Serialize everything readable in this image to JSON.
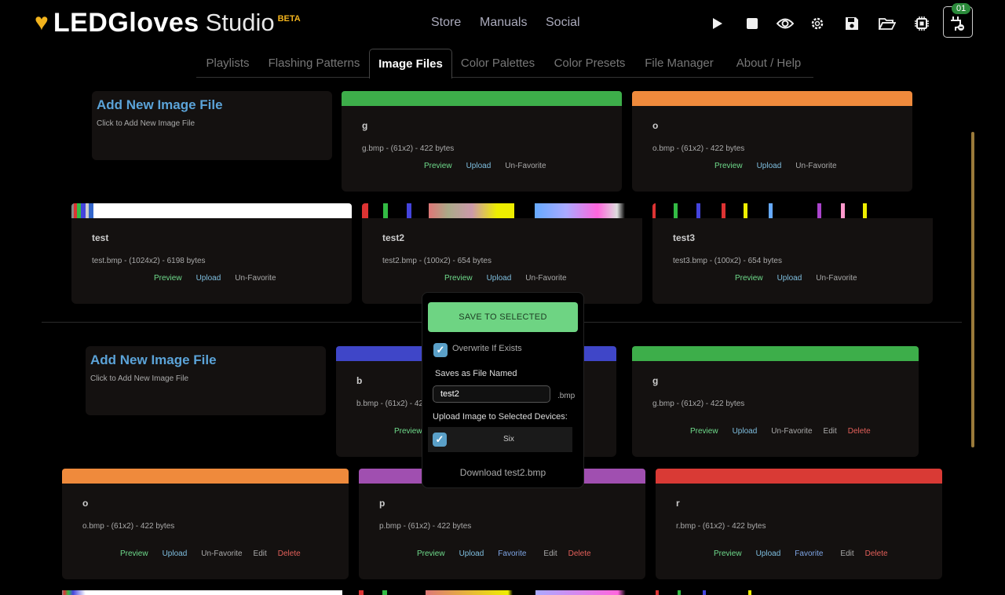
{
  "header": {
    "brand": "LEDGloves",
    "studio": "Studio",
    "beta": "BETA",
    "nav": [
      "Store",
      "Manuals",
      "Social"
    ],
    "device_count": "01",
    "icons": [
      "play-icon",
      "stop-icon",
      "eye-icon",
      "gear-icon",
      "save-icon",
      "folder-open-icon",
      "chip-icon",
      "plug-icon"
    ]
  },
  "tabs": [
    {
      "label": "Playlists",
      "active": false
    },
    {
      "label": "Flashing Patterns",
      "active": false
    },
    {
      "label": "Image Files",
      "active": true
    },
    {
      "label": "Color Palettes",
      "active": false
    },
    {
      "label": "Color Presets",
      "active": false
    },
    {
      "label": "File Manager",
      "active": false
    },
    {
      "label": "About / Help",
      "active": false
    }
  ],
  "add_card": {
    "title": "Add New Image File",
    "subtitle": "Click to Add New Image File"
  },
  "actions": {
    "preview": "Preview",
    "upload": "Upload",
    "unfavorite": "Un-Favorite",
    "favorite": "Favorite",
    "edit": "Edit",
    "delete": "Delete"
  },
  "section1": {
    "files": [
      {
        "name": "g",
        "meta": "g.bmp - (61x2) - 422 bytes",
        "color": "#3dae4a"
      },
      {
        "name": "o",
        "meta": "o.bmp - (61x2) - 422 bytes",
        "color": "#ef8a3c"
      },
      {
        "name": "test",
        "meta": "test.bmp - (1024x2) - 6198 bytes",
        "color": "#ffffff"
      },
      {
        "name": "test2",
        "meta": "test2.bmp - (100x2) - 654 bytes",
        "color": "#000000"
      },
      {
        "name": "test3",
        "meta": "test3.bmp - (100x2) - 654 bytes",
        "color": "#000000"
      }
    ]
  },
  "section2": {
    "files": [
      {
        "name": "b",
        "meta": "b.bmp - (61x2) - 422 bytes",
        "color": "#3f46c8"
      },
      {
        "name": "g",
        "meta": "g.bmp - (61x2) - 422 bytes",
        "color": "#3dae4a"
      },
      {
        "name": "o",
        "meta": "o.bmp - (61x2) - 422 bytes",
        "color": "#ef8a3c"
      },
      {
        "name": "p",
        "meta": "p.bmp - (61x2) - 422 bytes",
        "color": "#a04fb0"
      },
      {
        "name": "r",
        "meta": "r.bmp - (61x2) - 422 bytes",
        "color": "#d93a35"
      }
    ]
  },
  "popup": {
    "save_button": "SAVE TO SELECTED",
    "overwrite_label": "Overwrite If Exists",
    "overwrite_checked": true,
    "saves_as_label": "Saves as File Named",
    "filename_value": "test2",
    "extension": ".bmp",
    "upload_label": "Upload Image to Selected Devices:",
    "device_name": "Six",
    "device_checked": true,
    "download_label": "Download test2.bmp"
  }
}
